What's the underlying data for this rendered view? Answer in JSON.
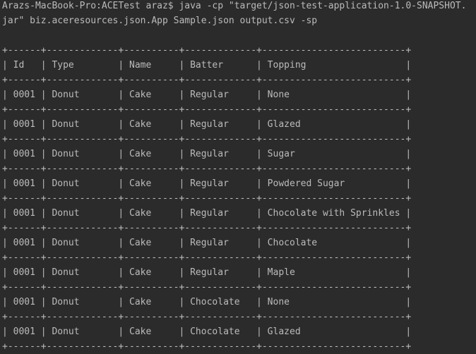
{
  "terminal": {
    "command_line_1": "Arazs-MacBook-Pro:ACETest araz$ java -cp \"target/json-test-application-1.0-SNAPSHOT.",
    "command_line_2": "jar\" biz.aceresources.json.App Sample.json output.csv -sp",
    "table": {
      "border": "+------+-------------+----------+-------------+--------------------------+",
      "header": "| Id   | Type        | Name     | Batter      | Topping                  |",
      "rows": [
        "| 0001 | Donut       | Cake     | Regular     | None                     |",
        "| 0001 | Donut       | Cake     | Regular     | Glazed                   |",
        "| 0001 | Donut       | Cake     | Regular     | Sugar                    |",
        "| 0001 | Donut       | Cake     | Regular     | Powdered Sugar           |",
        "| 0001 | Donut       | Cake     | Regular     | Chocolate with Sprinkles |",
        "| 0001 | Donut       | Cake     | Regular     | Chocolate                |",
        "| 0001 | Donut       | Cake     | Regular     | Maple                    |",
        "| 0001 | Donut       | Cake     | Chocolate   | None                     |",
        "| 0001 | Donut       | Cake     | Chocolate   | Glazed                   |"
      ]
    }
  },
  "colors": {
    "background": "#2b2b2b",
    "text": "#bbbbbb"
  }
}
